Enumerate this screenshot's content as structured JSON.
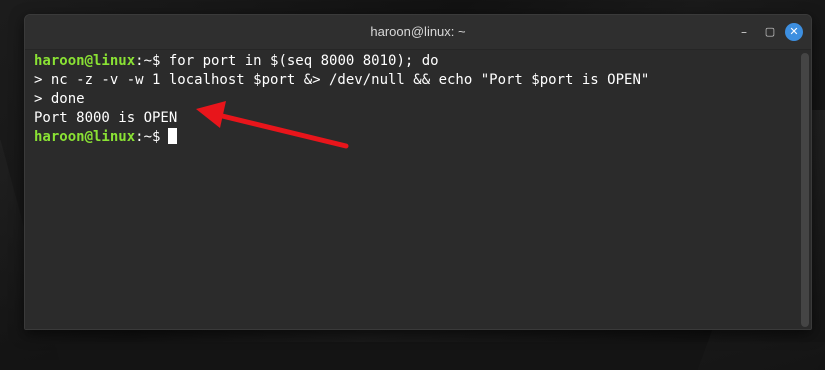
{
  "window": {
    "title": "haroon@linux: ~",
    "controls": {
      "minimize_icon": "–",
      "maximize_icon": "▢",
      "close_icon": "✕"
    }
  },
  "terminal": {
    "lines": [
      {
        "user": "haroon@linux",
        "sep": ":~$ ",
        "text": "for port in $(seq 8000 8010); do"
      },
      {
        "text": "> nc -z -v -w 1 localhost $port &> /dev/null && echo \"Port $port is OPEN\""
      },
      {
        "text": "> done"
      },
      {
        "text": "Port 8000 is OPEN"
      },
      {
        "user": "haroon@linux",
        "sep": ":~$",
        "text": ""
      }
    ]
  },
  "colors": {
    "prompt_user": "#8ae234",
    "annotation_arrow": "#e8151b",
    "close_button": "#3d8fe0"
  },
  "annotation": {
    "icon": "red-arrow-icon",
    "points_to": "Port 8000 is OPEN"
  }
}
